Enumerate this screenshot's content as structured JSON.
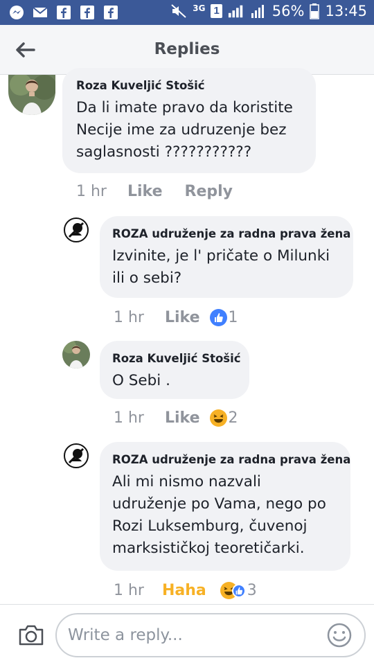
{
  "status_bar": {
    "network": "3G",
    "sim": "1",
    "battery": "56%",
    "time": "13:45"
  },
  "header": {
    "title": "Replies"
  },
  "comments": [
    {
      "author": "Roza Kuveljić Stošić",
      "lines": [
        "Da li imate pravo da koristite",
        "Necije ime za udruzenje bez",
        "saglasnosti ???????????"
      ],
      "time": "1 hr",
      "like_label": "Like",
      "reply_label": "Reply"
    },
    {
      "author": "ROZA udruženje za radna prava žena",
      "lines": [
        "Izvinite, je l' pričate o Milunki",
        "ili o sebi?"
      ],
      "time": "1 hr",
      "like_label": "Like",
      "reaction_count": "1"
    },
    {
      "author": "Roza Kuveljić Stošić",
      "lines": [
        "O Sebi ."
      ],
      "time": "1 hr",
      "like_label": "Like",
      "reaction_count": "2"
    },
    {
      "author": "ROZA udruženje za radna prava žena",
      "lines": [
        "Ali mi nismo nazvali",
        "udruženje po Vama, nego po",
        "Rozi Luksemburg, čuvenoj",
        "marksističkoj teoretičarki."
      ],
      "time": "1 hr",
      "like_label": "Haha",
      "reaction_count": "3"
    }
  ],
  "composer": {
    "placeholder": "Write a reply..."
  },
  "colors": {
    "brand": "#3b5998",
    "bubble": "#f1f2f5",
    "like_blue": "#4080ff",
    "haha_yellow": "#f7b125",
    "meta_gray": "#90949c"
  }
}
